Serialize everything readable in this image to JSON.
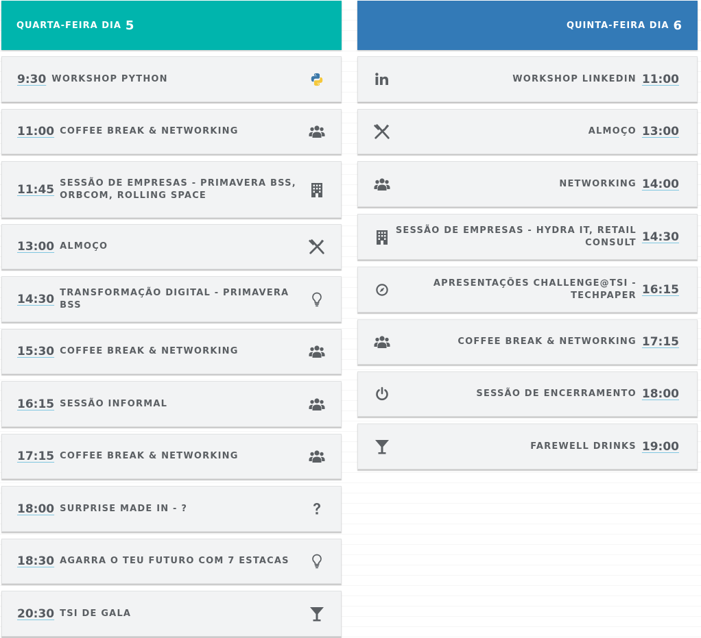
{
  "wednesday": {
    "day_label": "Quarta-Feira dia",
    "day_number": "5",
    "header_color": "#00b5ad",
    "events": [
      {
        "time": "9:30",
        "title": "Workshop Python",
        "icon": "python-icon"
      },
      {
        "time": "11:00",
        "title": "Coffee Break & Networking",
        "icon": "users-icon"
      },
      {
        "time": "11:45",
        "title": "Sessão de Empresas - Primavera BSS, Orbcom, Rolling Space",
        "icon": "building-icon"
      },
      {
        "time": "13:00",
        "title": "Almoço",
        "icon": "cutlery-icon"
      },
      {
        "time": "14:30",
        "title": "Transformação Digital - Primavera BSS",
        "icon": "lightbulb-icon"
      },
      {
        "time": "15:30",
        "title": "Coffee Break & Networking",
        "icon": "users-icon"
      },
      {
        "time": "16:15",
        "title": "Sessão Informal",
        "icon": "users-icon"
      },
      {
        "time": "17:15",
        "title": "Coffee Break & Networking",
        "icon": "users-icon"
      },
      {
        "time": "18:00",
        "title": "Surprise Made In - ?",
        "icon": "question-icon"
      },
      {
        "time": "18:30",
        "title": "Agarra o teu futuro com 7 estacas",
        "icon": "lightbulb-icon"
      },
      {
        "time": "20:30",
        "title": "TSI de Gala",
        "icon": "cocktail-icon"
      }
    ]
  },
  "thursday": {
    "day_label": "Quinta-Feira dia",
    "day_number": "6",
    "header_color": "#337ab7",
    "events": [
      {
        "time": "11:00",
        "title": "Workshop LinkedIn",
        "icon": "linkedin-icon"
      },
      {
        "time": "13:00",
        "title": "Almoço",
        "icon": "cutlery-icon"
      },
      {
        "time": "14:00",
        "title": "Networking",
        "icon": "users-icon"
      },
      {
        "time": "14:30",
        "title": "Sessão de Empresas - Hydra IT, Retail Consult",
        "icon": "building-icon"
      },
      {
        "time": "16:15",
        "title": "Apresentações Challenge@TSI - TechPaper",
        "icon": "compass-icon"
      },
      {
        "time": "17:15",
        "title": "Coffee Break & Networking",
        "icon": "users-icon"
      },
      {
        "time": "18:00",
        "title": "Sessão de Encerramento",
        "icon": "power-icon"
      },
      {
        "time": "19:00",
        "title": "Farewell Drinks",
        "icon": "cocktail-icon"
      }
    ]
  }
}
